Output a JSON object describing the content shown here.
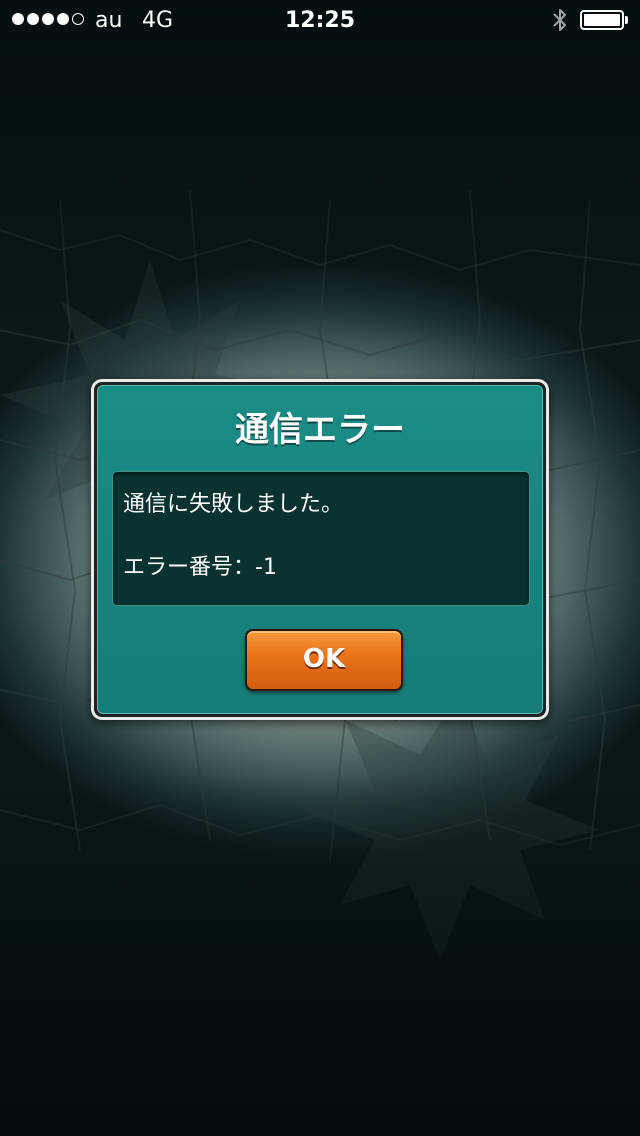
{
  "status_bar": {
    "carrier": "au",
    "network": "4G",
    "time": "12:25",
    "signal_bars_filled": 4,
    "signal_bars_total": 5,
    "bluetooth_icon": "bluetooth-icon",
    "battery_level": 1.0
  },
  "dialog": {
    "title": "通信エラー",
    "message_line_1": "通信に失敗しました。",
    "message_line_2": "エラー番号：-1",
    "ok_label": "OK"
  },
  "colors": {
    "dialog_teal": "#1a8c86",
    "message_bg": "#07322f",
    "button_orange": "#e9711a"
  }
}
